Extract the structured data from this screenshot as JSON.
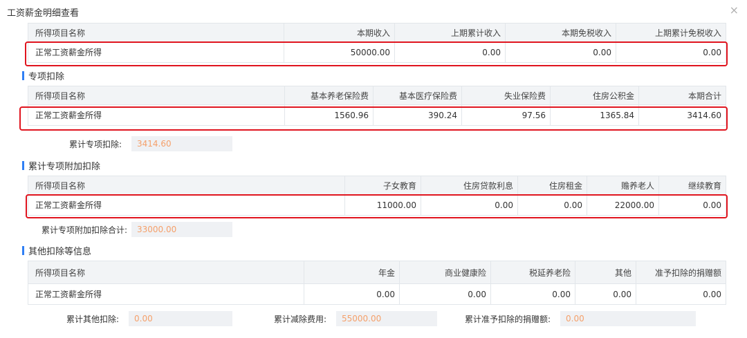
{
  "dialog": {
    "title": "工资薪金明细查看",
    "close_glyph": "×"
  },
  "income": {
    "headers": [
      "所得项目名称",
      "本期收入",
      "上期累计收入",
      "本期免税收入",
      "上期累计免税收入"
    ],
    "row": [
      "正常工资薪金所得",
      "50000.00",
      "0.00",
      "0.00",
      "0.00"
    ]
  },
  "special": {
    "section_title": "专项扣除",
    "headers": [
      "所得项目名称",
      "基本养老保险费",
      "基本医疗保险费",
      "失业保险费",
      "住房公积金",
      "本期合计"
    ],
    "row": [
      "正常工资薪金所得",
      "1560.96",
      "390.24",
      "97.56",
      "1365.84",
      "3414.60"
    ],
    "total_label": "累计专项扣除:",
    "total_value": "3414.60"
  },
  "additional": {
    "section_title": "累计专项附加扣除",
    "headers": [
      "所得项目名称",
      "子女教育",
      "住房贷款利息",
      "住房租金",
      "赡养老人",
      "继续教育"
    ],
    "row": [
      "正常工资薪金所得",
      "11000.00",
      "0.00",
      "0.00",
      "22000.00",
      "0.00"
    ],
    "total_label": "累计专项附加扣除合计:",
    "total_value": "33000.00"
  },
  "other": {
    "section_title": "其他扣除等信息",
    "headers": [
      "所得项目名称",
      "年金",
      "商业健康险",
      "税延养老险",
      "其他",
      "准予扣除的捐赠额"
    ],
    "row": [
      "正常工资薪金所得",
      "0.00",
      "0.00",
      "0.00",
      "0.00",
      "0.00"
    ],
    "summary": [
      {
        "label": "累计其他扣除:",
        "value": "0.00"
      },
      {
        "label": "累计减除费用:",
        "value": "55000.00"
      },
      {
        "label": "累计准予扣除的捐赠额:",
        "value": "0.00"
      }
    ]
  },
  "colors": {
    "accent_bar": "#2f7ff5",
    "highlight_box": "#e0141e",
    "summary_value": "#f5a06a",
    "header_bg": "#f2f4f6"
  }
}
